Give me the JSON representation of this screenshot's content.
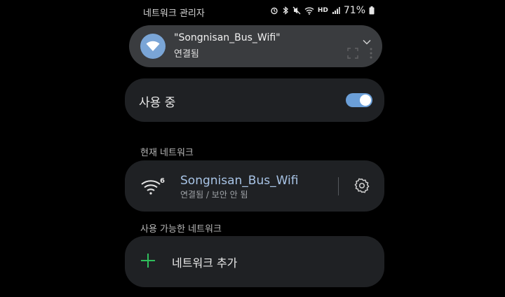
{
  "status_bar": {
    "app_title": "네트워크 관리자",
    "hd_label": "HD",
    "battery_percent": "71%"
  },
  "notification": {
    "title": "\"Songnisan_Bus_Wifi\"",
    "subtitle": "연결됨"
  },
  "usage": {
    "label": "사용 중",
    "toggle_on": true
  },
  "current_network": {
    "section_label": "현재 네트워크",
    "name": "Songnisan_Bus_Wifi",
    "status": "연결됨 / 보안 안 됨",
    "wifi_generation": "6"
  },
  "available_networks": {
    "section_label": "사용 가능한 네트워크",
    "add_label": "네트워크 추가"
  },
  "colors": {
    "accent": "#6b9fd8",
    "card_bg": "#1f2124",
    "add_plus": "#2fbf5c"
  }
}
